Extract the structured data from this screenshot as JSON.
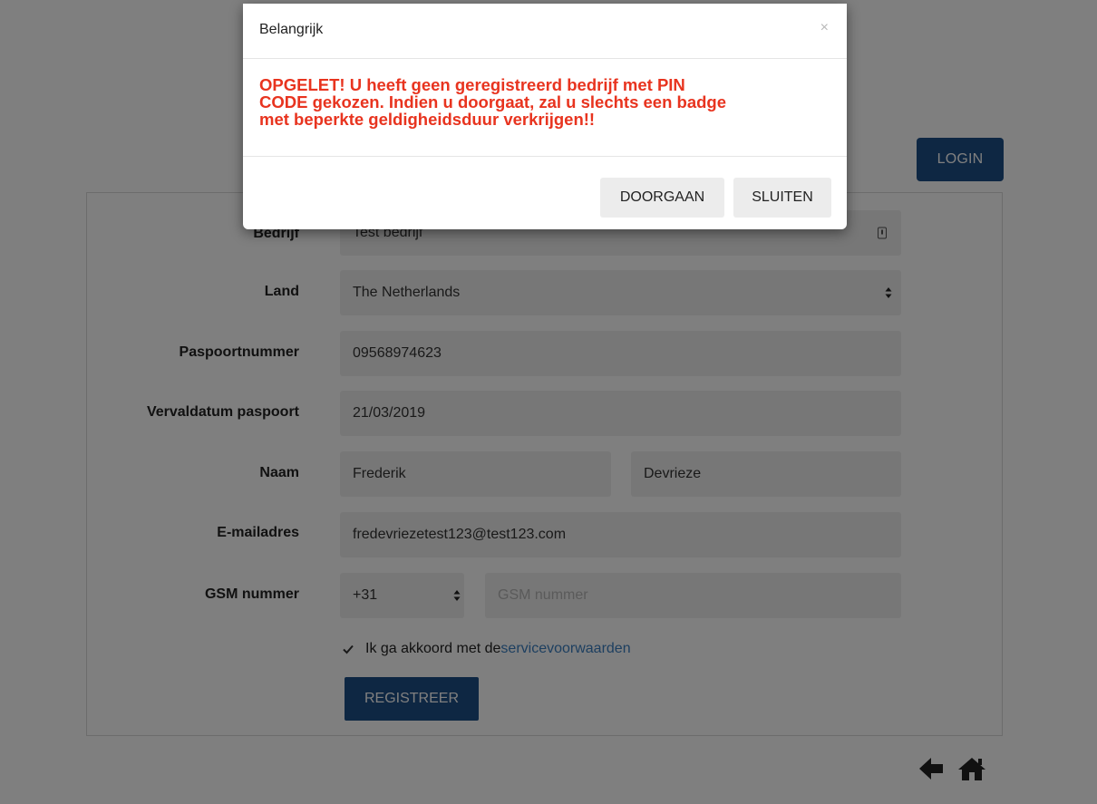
{
  "header": {
    "login_label": "LOGIN"
  },
  "form": {
    "company": {
      "label": "Bedrijf",
      "value": "Test bedrijf"
    },
    "country": {
      "label": "Land",
      "value": "The Netherlands"
    },
    "passport": {
      "label": "Paspoortnummer",
      "value": "09568974623"
    },
    "passport_expiry": {
      "label": "Vervaldatum paspoort",
      "value": "21/03/2019"
    },
    "name": {
      "label": "Naam",
      "first": "Frederik",
      "last": "Devrieze"
    },
    "email": {
      "label": "E-mailadres",
      "value": "fredevriezetest123@test123.com"
    },
    "phone": {
      "label": "GSM nummer",
      "prefix": "+31",
      "placeholder": "GSM nummer"
    },
    "terms": {
      "text": "Ik ga akkoord met de ",
      "link": "servicevoorwaarden",
      "checked": true
    },
    "register_label": "REGISTREER"
  },
  "nav": {
    "back_icon": "arrow-left-icon",
    "home_icon": "home-icon"
  },
  "modal": {
    "title": "Belangrijk",
    "close": "×",
    "message_lines": [
      "OPGELET! U heeft geen geregistreerd bedrijf met PIN",
      "CODE gekozen. Indien u doorgaat, zal u slechts een badge",
      "met beperkte geldigheidsduur verkrijgen!!"
    ],
    "continue_label": "DOORGAAN",
    "close_label": "SLUITEN"
  },
  "colors": {
    "primary": "#1d4f86",
    "warning": "#e8341f",
    "link": "#3a7ec0",
    "overlay": "rgba(0,0,0,0.5)"
  }
}
